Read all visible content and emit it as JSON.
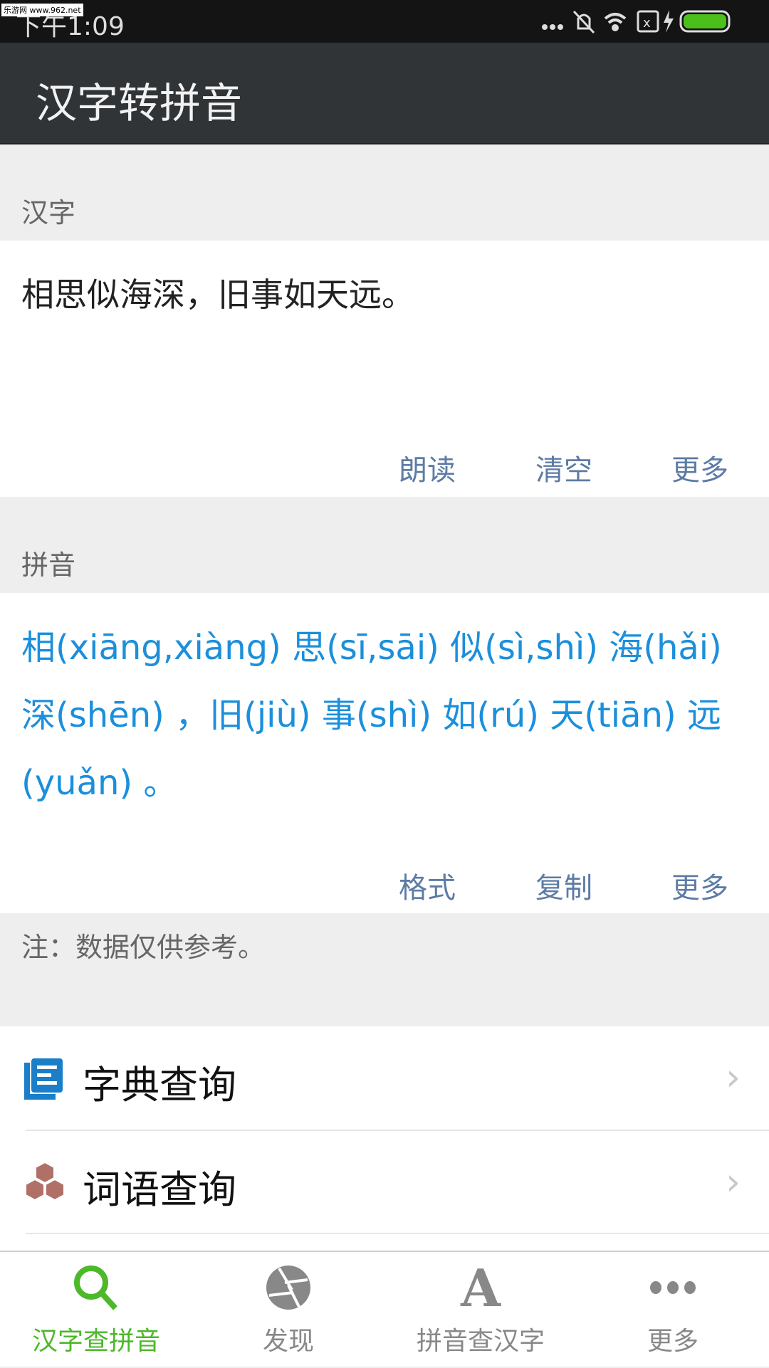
{
  "status_bar": {
    "time": "下午1:09",
    "watermark": "乐游网 www.962.net",
    "icons": [
      "more-dots-icon",
      "vibrate-off-icon",
      "wifi-icon",
      "no-sim-icon",
      "charging-icon",
      "battery-icon"
    ],
    "battery_color": "#4cc01a"
  },
  "app_bar": {
    "title": "汉字转拼音"
  },
  "hanzi_section": {
    "label": "汉字",
    "input_value": "相思似海深，旧事如天远。",
    "actions": [
      "朗读",
      "清空",
      "更多"
    ]
  },
  "pinyin_section": {
    "label": "拼音",
    "result": "相(xiāng,xiàng) 思(sī,sāi) 似(sì,shì) 海(hǎi) 深(shēn) ，旧(jiù) 事(shì) 如(rú) 天(tiān) 远(yuǎn) 。",
    "actions": [
      "格式",
      "复制",
      "更多"
    ]
  },
  "note": "注：数据仅供参考。",
  "list": [
    {
      "label": "字典查询",
      "icon": "dictionary-book-icon"
    },
    {
      "label": "词语查询",
      "icon": "cubes-icon"
    }
  ],
  "bottom_nav": {
    "active_color": "#4cb82a",
    "tabs": [
      {
        "label": "汉字查拼音",
        "icon": "search-icon",
        "active": true
      },
      {
        "label": "发现",
        "icon": "aperture-icon"
      },
      {
        "label": "拼音查汉字",
        "icon": "letter-a-icon"
      },
      {
        "label": "更多",
        "icon": "more-dots-icon"
      }
    ]
  },
  "colors": {
    "accent_blue": "#1b8fdc",
    "action_text": "#5d7ba5",
    "app_bar": "#303436"
  }
}
